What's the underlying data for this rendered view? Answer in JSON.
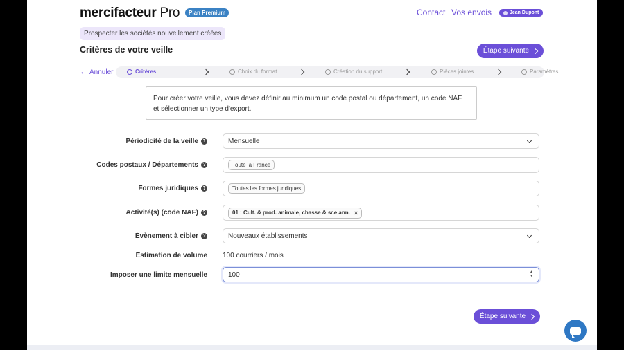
{
  "header": {
    "logo_text": "mercifacteur",
    "logo_suffix": "Pro",
    "plan_badge": "Plan Premium",
    "nav_contact": "Contact",
    "nav_envois": "Vos envois",
    "user_name": "Jean Dupont"
  },
  "page": {
    "pill_title": "Prospecter les sociétés nouvellement créées",
    "section_title": "Critères de votre veille",
    "next_label": "Étape suivante",
    "cancel_label": "Annuler"
  },
  "steps": [
    {
      "label": "Critères",
      "active": true
    },
    {
      "label": "Choix du format",
      "active": false
    },
    {
      "label": "Création du support",
      "active": false
    },
    {
      "label": "Pièces jointes",
      "active": false
    },
    {
      "label": "Paramètres",
      "active": false
    }
  ],
  "info_text": "Pour créer votre veille, vous devez définir au minimum un code postal ou département, un code NAF et sélectionner un type d'export.",
  "form": {
    "periodicity": {
      "label": "Périodicité de la veille",
      "value": "Mensuelle"
    },
    "postal": {
      "label": "Codes postaux / Départements",
      "tag": "Toute la France"
    },
    "legal": {
      "label": "Formes juridiques",
      "tag": "Toutes les formes juridiques"
    },
    "naf": {
      "label": "Activité(s) (code NAF)",
      "tag": "01 : Cult. & prod. animale, chasse & sce ann.",
      "remove": "×"
    },
    "event": {
      "label": "Évènement à cibler",
      "value": "Nouveaux établissements"
    },
    "estimate": {
      "label": "Estimation de volume",
      "value": "100 courriers / mois"
    },
    "limit": {
      "label": "Imposer une limite mensuelle",
      "value": "100"
    }
  },
  "icons": {
    "help": "?",
    "spinner_up": "▲",
    "spinner_down": "▼"
  },
  "colors": {
    "accent": "#6b4fd8",
    "badge_blue": "#3b82c4",
    "chat": "#2f78c4"
  }
}
